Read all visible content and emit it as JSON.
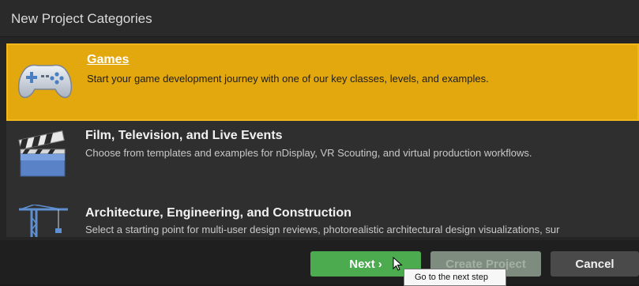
{
  "window": {
    "title": "New Project Categories"
  },
  "categories": [
    {
      "title": "Games",
      "description": "Start your game development journey with one of our key classes, levels, and examples.",
      "icon": "gamepad-icon",
      "selected": true
    },
    {
      "title": "Film, Television, and Live Events",
      "description": "Choose from templates and examples for nDisplay, VR Scouting, and virtual production workflows.",
      "icon": "clapperboard-icon",
      "selected": false
    },
    {
      "title": "Architecture, Engineering, and Construction",
      "description": "Select a starting point for multi-user design reviews, photorealistic architectural design visualizations, sur",
      "icon": "crane-icon",
      "selected": false
    }
  ],
  "footer": {
    "next_label": "Next",
    "create_label": "Create Project",
    "cancel_label": "Cancel"
  },
  "tooltip": {
    "text": "Go to the next step"
  },
  "colors": {
    "selected": "#e3a80d",
    "primary_button": "#4cab4f",
    "disabled_button": "#7d8c7e",
    "cancel_button": "#4a4a4a"
  }
}
